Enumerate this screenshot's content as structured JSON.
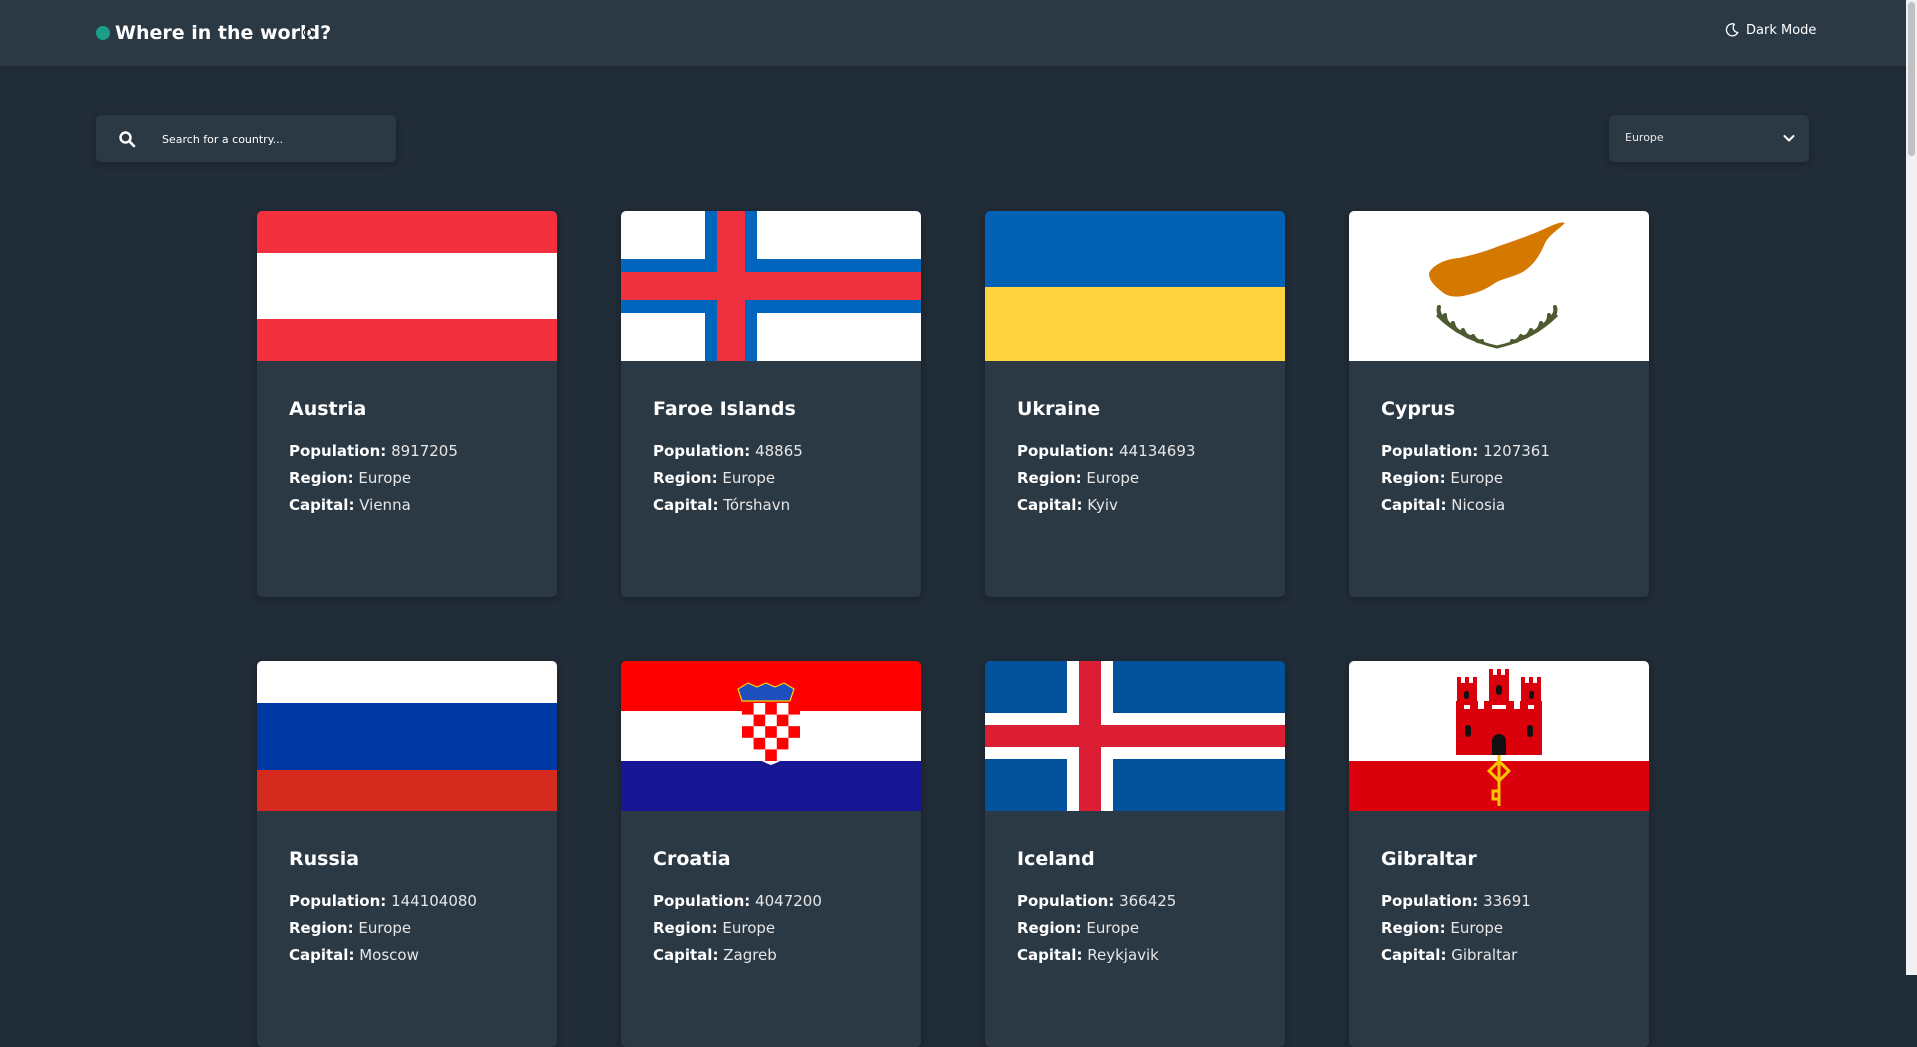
{
  "header": {
    "title": "Where in the world?",
    "mode_label": "Dark Mode",
    "moon_icon": "moon-icon"
  },
  "search": {
    "placeholder": "Search for a country...",
    "icon": "search-icon"
  },
  "filter": {
    "selected": "Europe",
    "icon": "chevron-down-icon"
  },
  "labels": {
    "population": "Population:",
    "region": "Region:",
    "capital": "Capital:"
  },
  "countries": [
    {
      "name": "Austria",
      "population": "8917205",
      "region": "Europe",
      "capital": "Vienna"
    },
    {
      "name": "Faroe Islands",
      "population": "48865",
      "region": "Europe",
      "capital": "Tórshavn"
    },
    {
      "name": "Ukraine",
      "population": "44134693",
      "region": "Europe",
      "capital": "Kyiv"
    },
    {
      "name": "Cyprus",
      "population": "1207361",
      "region": "Europe",
      "capital": "Nicosia"
    },
    {
      "name": "Russia",
      "population": "144104080",
      "region": "Europe",
      "capital": "Moscow"
    },
    {
      "name": "Croatia",
      "population": "4047200",
      "region": "Europe",
      "capital": "Zagreb"
    },
    {
      "name": "Iceland",
      "population": "366425",
      "region": "Europe",
      "capital": "Reykjavik"
    },
    {
      "name": "Gibraltar",
      "population": "33691",
      "region": "Europe",
      "capital": "Gibraltar"
    }
  ],
  "colors": {
    "background": "#202c37",
    "element": "#2b3945",
    "text": "#ffffff",
    "logo_dot": "#1a9e8a"
  }
}
